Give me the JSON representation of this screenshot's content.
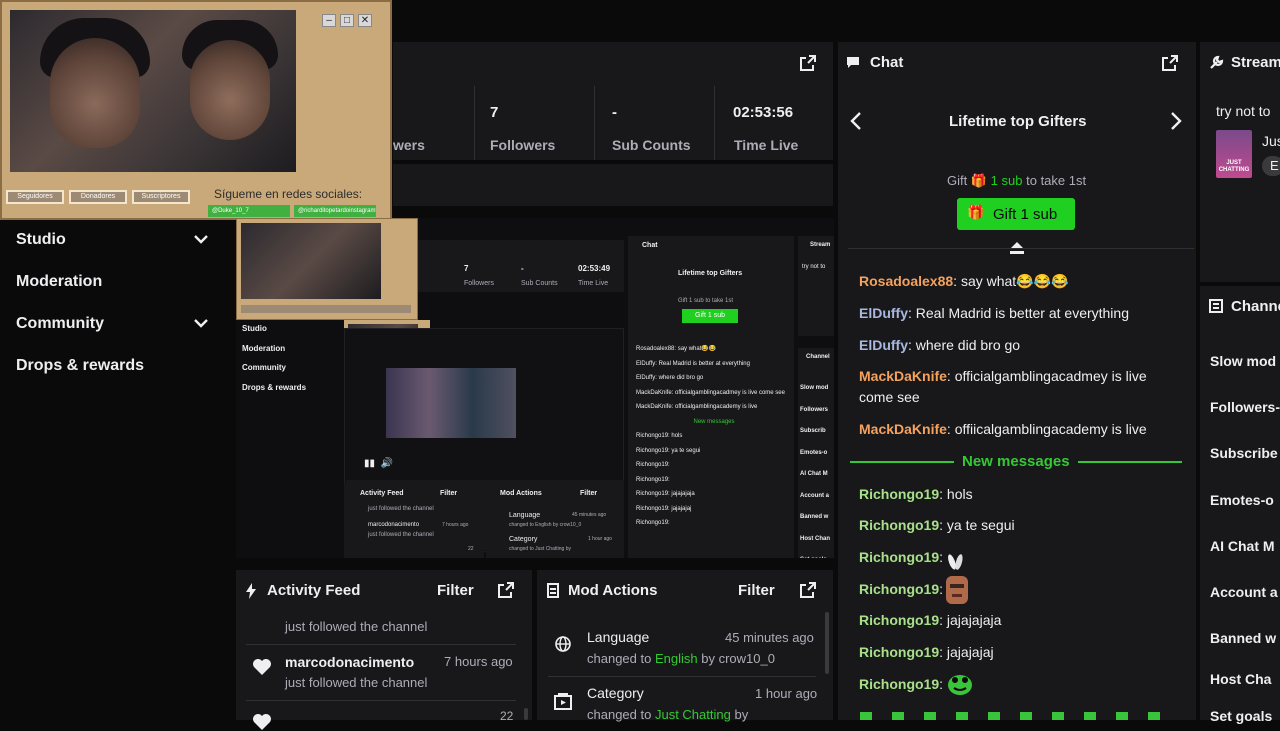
{
  "overlay": {
    "buttons": [
      "Seguidores",
      "Donadores",
      "Suscriptores"
    ],
    "socials_text": "Sígueme en redes sociales:",
    "handles": [
      "@Duke_10_7",
      "@richarditopetardoinstagramtutorial"
    ]
  },
  "stats": {
    "partial_label": "wers",
    "items": [
      {
        "value": "7",
        "label": "Followers"
      },
      {
        "value": "-",
        "label": "Sub Counts"
      },
      {
        "value": "02:53:56",
        "label": "Time Live"
      }
    ]
  },
  "nav": {
    "items": [
      {
        "label": "Studio",
        "expandable": true
      },
      {
        "label": "Moderation",
        "expandable": false
      },
      {
        "label": "Community",
        "expandable": true
      },
      {
        "label": "Drops & rewards",
        "expandable": false
      }
    ]
  },
  "nested": {
    "stats": {
      "followers_value": "7",
      "followers_label": "Followers",
      "subs_value": "-",
      "subs_label": "Sub Counts",
      "time_value": "02:53:49",
      "time_label": "Time Live"
    },
    "nav": [
      "Studio",
      "Moderation",
      "Community",
      "Drops & rewards"
    ],
    "chat_title": "Chat",
    "gifters_title": "Lifetime top Gifters",
    "gift_prompt": "Gift 1 sub to take 1st",
    "gift_button": "Gift 1 sub",
    "chat_lines": [
      "Rosadoalex88: say what😂😂",
      "ElDuffy: Real Madrid is better at everything",
      "ElDuffy: where did bro go",
      "MackDaKnife: officialgamblingacadmey is live come see",
      "MackDaKnife: officialgamblingacademy is live",
      "Richongo19: hols",
      "Richongo19: ya te segui",
      "Richongo19:",
      "Richongo19:",
      "Richongo19: jajajajaja",
      "Richongo19: jajajajaj",
      "Richongo19:"
    ],
    "new_messages": "New messages",
    "stream_label": "Stream",
    "stream_text": "try not to",
    "channel_label": "Channel",
    "channel_items": [
      "Slow mod",
      "Followers",
      "Subscrib",
      "Emotes-o",
      "AI Chat M",
      "Account a",
      "Banned w",
      "Host Chan",
      "Set goals"
    ],
    "activity": {
      "title": "Activity Feed",
      "filter": "Filter",
      "line1": "just followed the channel",
      "user": "marcodonacimento",
      "time": "7 hours ago",
      "line2": "just followed the channel",
      "count": "22"
    },
    "mod": {
      "title": "Mod Actions",
      "filter": "Filter",
      "lang_title": "Language",
      "lang_time": "45 minutes ago",
      "lang_detail": "changed to English by crow10_0",
      "cat_title": "Category",
      "cat_time": "1 hour ago",
      "cat_detail": "changed to Just Chatting by"
    }
  },
  "chat": {
    "title": "Chat",
    "gifters_title": "Lifetime top Gifters",
    "gift_prompt_pre": "Gift",
    "gift_prompt_highlight": "1 sub",
    "gift_prompt_post": "to take 1st",
    "gift_button": "Gift 1 sub",
    "new_messages": "New messages",
    "messages": [
      {
        "user": "Rosadoalex88",
        "text": "say what😂😂😂",
        "color": "#f5a25d"
      },
      {
        "user": "ElDuffy",
        "text": "Real Madrid is better at everything",
        "color": "#a8b8e0"
      },
      {
        "user": "ElDuffy",
        "text": "where did bro go",
        "color": "#a8b8e0"
      },
      {
        "user": "MackDaKnife",
        "text": "officialgamblingacadmey is live come see",
        "color": "#f5a25d"
      },
      {
        "user": "MackDaKnife",
        "text": "offiicalgamblingacademy is live",
        "color": "#f5a25d"
      },
      {
        "user": "Richongo19",
        "text": "hols",
        "color": "#a8e08a"
      },
      {
        "user": "Richongo19",
        "text": "ya te segui",
        "color": "#a8e08a"
      },
      {
        "user": "Richongo19",
        "text": "",
        "color": "#a8e08a"
      },
      {
        "user": "Richongo19",
        "text": "",
        "color": "#a8e08a"
      },
      {
        "user": "Richongo19",
        "text": "jajajajaja",
        "color": "#a8e08a"
      },
      {
        "user": "Richongo19",
        "text": "jajajajaj",
        "color": "#a8e08a"
      },
      {
        "user": "Richongo19",
        "text": "",
        "color": "#a8e08a"
      }
    ]
  },
  "stream": {
    "title": "Stream",
    "text": "try not to",
    "partial_name": "Jus",
    "partial_tag": "E",
    "category_art": "JUST CHATTING"
  },
  "channel": {
    "title": "Channe",
    "items": [
      "Slow mod",
      "Followers-",
      "Subscribe",
      "Emotes-o",
      "AI Chat M",
      "Account a",
      "Banned w",
      "Host Cha",
      "Set goals"
    ]
  },
  "activity": {
    "title": "Activity Feed",
    "filter": "Filter",
    "line1": "just followed the channel",
    "user": "marcodonacimento",
    "time": "7 hours ago",
    "line2": "just followed the channel",
    "count": "22"
  },
  "mod": {
    "title": "Mod Actions",
    "filter": "Filter",
    "lang_title": "Language",
    "lang_time": "45 minutes ago",
    "lang_changed": "changed to",
    "lang_value": "English",
    "lang_by": "by crow10_0",
    "cat_title": "Category",
    "cat_time": "1 hour ago",
    "cat_changed": "changed to",
    "cat_value": "Just Chatting",
    "cat_by": "by"
  },
  "colors": {
    "accent": "#00db84",
    "gift_green": "#20d020",
    "new_msg": "#34c934",
    "panel": "#18181b"
  }
}
